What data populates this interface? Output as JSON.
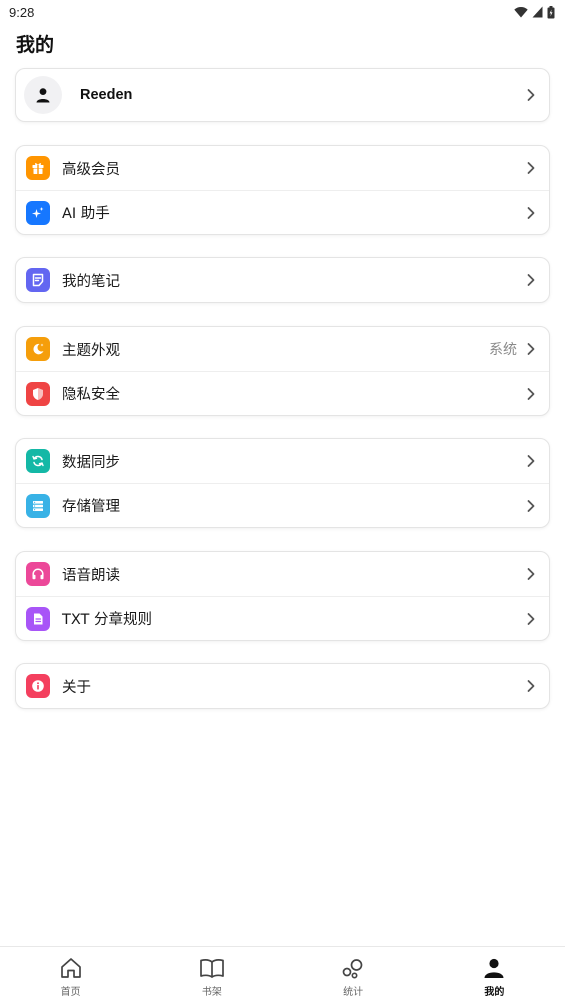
{
  "status_bar": {
    "time": "9:28",
    "icons": [
      "wifi-icon",
      "signal-icon",
      "battery-icon"
    ]
  },
  "page": {
    "title": "我的"
  },
  "profile": {
    "username": "Reeden",
    "icon": "person-icon"
  },
  "groups": [
    [
      {
        "label": "高级会员",
        "icon": "gift-icon",
        "color": "#ff9500"
      },
      {
        "label": "AI 助手",
        "icon": "sparkle-icon",
        "color": "#1677ff"
      }
    ],
    [
      {
        "label": "我的笔记",
        "icon": "note-icon",
        "color": "#6366f1"
      }
    ],
    [
      {
        "label": "主题外观",
        "icon": "moon-icon",
        "color": "#f59e0b",
        "value": "系统"
      },
      {
        "label": "隐私安全",
        "icon": "shield-icon",
        "color": "#ef4444"
      }
    ],
    [
      {
        "label": "数据同步",
        "icon": "sync-icon",
        "color": "#14b8a6"
      },
      {
        "label": "存储管理",
        "icon": "storage-icon",
        "color": "#38b2e6"
      }
    ],
    [
      {
        "label": "语音朗读",
        "icon": "headphones-icon",
        "color": "#ec4899"
      },
      {
        "label": "TXT 分章规则",
        "icon": "document-icon",
        "color": "#a855f7"
      }
    ],
    [
      {
        "label": "关于",
        "icon": "info-icon",
        "color": "#f43f5e"
      }
    ]
  ],
  "bottom_nav": [
    {
      "label": "首页",
      "icon": "home-icon",
      "active": false
    },
    {
      "label": "书架",
      "icon": "book-icon",
      "active": false
    },
    {
      "label": "统计",
      "icon": "stats-icon",
      "active": false
    },
    {
      "label": "我的",
      "icon": "person-icon",
      "active": true
    }
  ]
}
